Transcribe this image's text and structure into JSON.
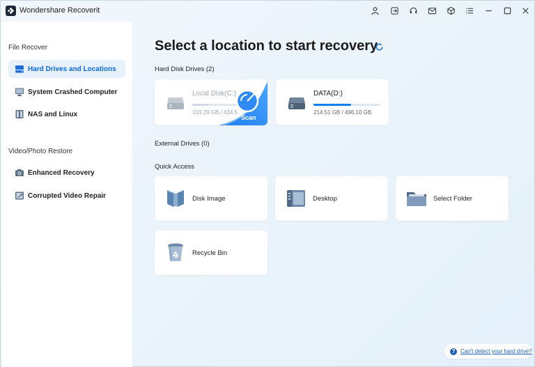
{
  "app": {
    "title": "Wondershare Recoverit"
  },
  "titlebar": {
    "icons": [
      "user-icon",
      "sign-in-icon",
      "headset-icon",
      "mail-icon",
      "box-icon",
      "menu-icon",
      "minimize-icon",
      "maximize-icon",
      "close-icon"
    ]
  },
  "sidebar": {
    "section_file_recover": "File Recover",
    "items_file": [
      {
        "label": "Hard Drives and Locations",
        "icon": "hard-drive-icon",
        "active": true
      },
      {
        "label": "System Crashed Computer",
        "icon": "computer-icon",
        "active": false
      },
      {
        "label": "NAS and Linux",
        "icon": "nas-icon",
        "active": false
      }
    ],
    "section_video": "Video/Photo Restore",
    "items_video": [
      {
        "label": "Enhanced Recovery",
        "icon": "camera-icon",
        "active": false
      },
      {
        "label": "Corrupted Video Repair",
        "icon": "video-repair-icon",
        "active": false
      }
    ]
  },
  "main": {
    "title": "Select a location to start recovery",
    "hard_disk_label": "Hard Disk Drives (2)",
    "drives": [
      {
        "name": "Local Disk(C:)",
        "size": "103.29 GB / 434.5",
        "used_fraction": 0.24,
        "scan_label": "Scan"
      },
      {
        "name": "DATA(D:)",
        "size": "214.51 GB / 496.10 GB",
        "used_fraction": 0.56
      }
    ],
    "external_label": "External Drives (0)",
    "quick_access_label": "Quick Access",
    "quick_access": [
      {
        "label": "Disk Image",
        "icon": "disk-image-icon"
      },
      {
        "label": "Desktop",
        "icon": "desktop-icon"
      },
      {
        "label": "Select Folder",
        "icon": "folder-icon"
      },
      {
        "label": "Recycle Bin",
        "icon": "recycle-bin-icon"
      }
    ]
  },
  "help": {
    "text": "Can't detect your hard drive?"
  },
  "colors": {
    "accent": "#0d6ad8",
    "bar": "#0d7ff2",
    "active_bg": "#e6f1fc"
  }
}
